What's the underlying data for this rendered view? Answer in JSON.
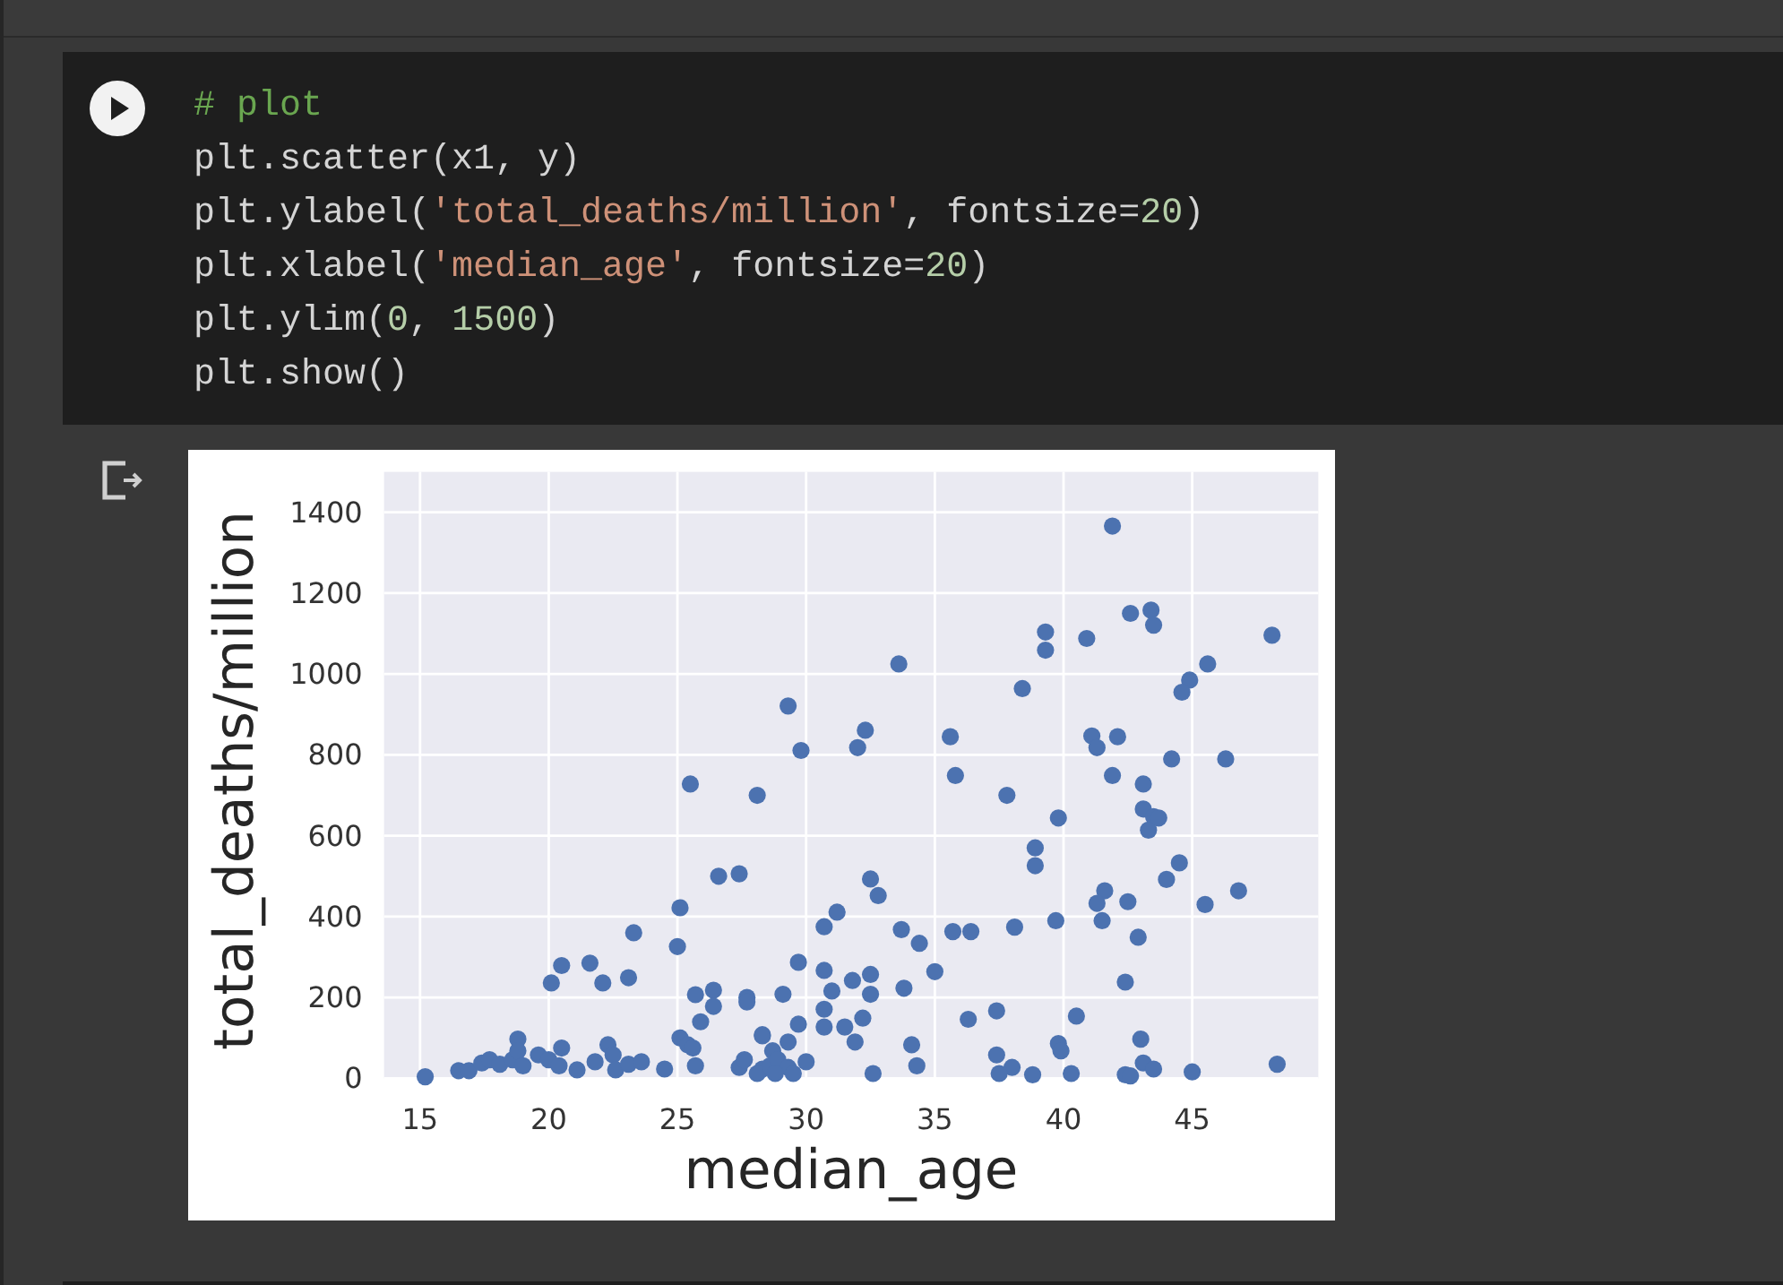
{
  "code_cell": {
    "lines": [
      [
        {
          "kind": "comment",
          "text": "# plot"
        }
      ],
      [
        {
          "kind": "plain",
          "text": "plt.scatter(x1, y)"
        }
      ],
      [
        {
          "kind": "plain",
          "text": "plt.ylabel("
        },
        {
          "kind": "string",
          "text": "'total_deaths/million'"
        },
        {
          "kind": "plain",
          "text": ", fontsize="
        },
        {
          "kind": "number",
          "text": "20"
        },
        {
          "kind": "plain",
          "text": ")"
        }
      ],
      [
        {
          "kind": "plain",
          "text": "plt.xlabel("
        },
        {
          "kind": "string",
          "text": "'median_age'"
        },
        {
          "kind": "plain",
          "text": ", fontsize="
        },
        {
          "kind": "number",
          "text": "20"
        },
        {
          "kind": "plain",
          "text": ")"
        }
      ],
      [
        {
          "kind": "plain",
          "text": "plt.ylim("
        },
        {
          "kind": "number",
          "text": "0"
        },
        {
          "kind": "plain",
          "text": ", "
        },
        {
          "kind": "number",
          "text": "1500"
        },
        {
          "kind": "plain",
          "text": ")"
        }
      ],
      [
        {
          "kind": "plain",
          "text": "plt.show()"
        }
      ]
    ]
  },
  "output": {
    "chart_data": {
      "type": "scatter",
      "xlabel": "median_age",
      "ylabel": "total_deaths/million",
      "grid": true,
      "xlim": [
        13.6,
        49.9
      ],
      "ylim": [
        0,
        1500
      ],
      "xticks": [
        15,
        20,
        25,
        30,
        35,
        40,
        45
      ],
      "yticks": [
        0,
        200,
        400,
        600,
        800,
        1000,
        1200,
        1400
      ],
      "x": [
        41.9,
        42.6,
        43.4,
        43.5,
        39.3,
        39.3,
        40.9,
        48.1,
        33.6,
        45.6,
        44.9,
        44.6,
        38.4,
        29.3,
        32.3,
        32.0,
        29.8,
        35.6,
        41.1,
        41.3,
        42.1,
        44.2,
        46.3,
        35.8,
        41.9,
        43.1,
        28.1,
        37.8,
        39.8,
        43.1,
        43.5,
        43.3,
        43.7,
        25.5,
        26.6,
        27.4,
        25.1,
        25.0,
        23.3,
        23.1,
        20.1,
        20.5,
        21.6,
        22.1,
        25.7,
        26.4,
        26.4,
        25.9,
        27.7,
        27.7,
        18.8,
        25.1,
        25.4,
        25.6,
        25.7,
        28.3,
        15.2,
        16.5,
        16.9,
        17.4,
        17.7,
        18.1,
        18.6,
        18.8,
        19.0,
        19.6,
        20.0,
        20.5,
        20.4,
        21.1,
        21.8,
        22.3,
        22.5,
        22.6,
        23.1,
        23.6,
        24.5,
        27.4,
        27.6,
        28.3,
        28.7,
        38.9,
        38.9,
        44.5,
        44.0,
        46.8,
        45.5,
        41.6,
        41.3,
        41.5,
        42.5,
        42.9,
        39.7,
        38.1,
        35.7,
        36.4,
        33.7,
        34.4,
        35.0,
        32.5,
        32.8,
        31.2,
        30.7,
        29.7,
        30.7,
        31.0,
        31.8,
        32.5,
        32.5,
        33.8,
        29.1,
        30.7,
        30.7,
        31.5,
        32.2,
        31.9,
        29.7,
        29.3,
        28.3,
        30.0,
        28.1,
        28.6,
        28.9,
        29.3,
        29.5,
        28.8,
        32.6,
        34.1,
        34.3,
        36.3,
        37.4,
        37.4,
        38.0,
        37.5,
        38.8,
        39.8,
        39.9,
        40.5,
        40.3,
        42.4,
        43.0,
        43.1,
        43.5,
        42.4,
        42.6,
        45.0,
        48.3
      ],
      "values": [
        1366,
        1150,
        1158,
        1121,
        1104,
        1059,
        1088,
        1096,
        1025,
        1025,
        985,
        955,
        964,
        921,
        861,
        818,
        811,
        845,
        847,
        818,
        845,
        790,
        790,
        749,
        749,
        728,
        700,
        700,
        644,
        666,
        647,
        614,
        644,
        728,
        500,
        506,
        422,
        326,
        360,
        249,
        236,
        279,
        285,
        236,
        207,
        218,
        178,
        140,
        200,
        189,
        97,
        100,
        83,
        75,
        31,
        108,
        4,
        19,
        19,
        38,
        46,
        35,
        46,
        68,
        31,
        58,
        46,
        75,
        31,
        21,
        41,
        83,
        58,
        21,
        35,
        41,
        23,
        27,
        46,
        23,
        68,
        570,
        526,
        533,
        492,
        464,
        430,
        464,
        433,
        390,
        437,
        349,
        390,
        374,
        363,
        363,
        368,
        334,
        264,
        493,
        452,
        411,
        375,
        287,
        267,
        216,
        242,
        257,
        208,
        223,
        208,
        171,
        127,
        127,
        149,
        90,
        134,
        90,
        105,
        41,
        12,
        31,
        46,
        27,
        12,
        12,
        12,
        83,
        31,
        146,
        167,
        58,
        27,
        12,
        9,
        86,
        68,
        154,
        12,
        238,
        97,
        38,
        23,
        9,
        6,
        16,
        35
      ]
    }
  }
}
